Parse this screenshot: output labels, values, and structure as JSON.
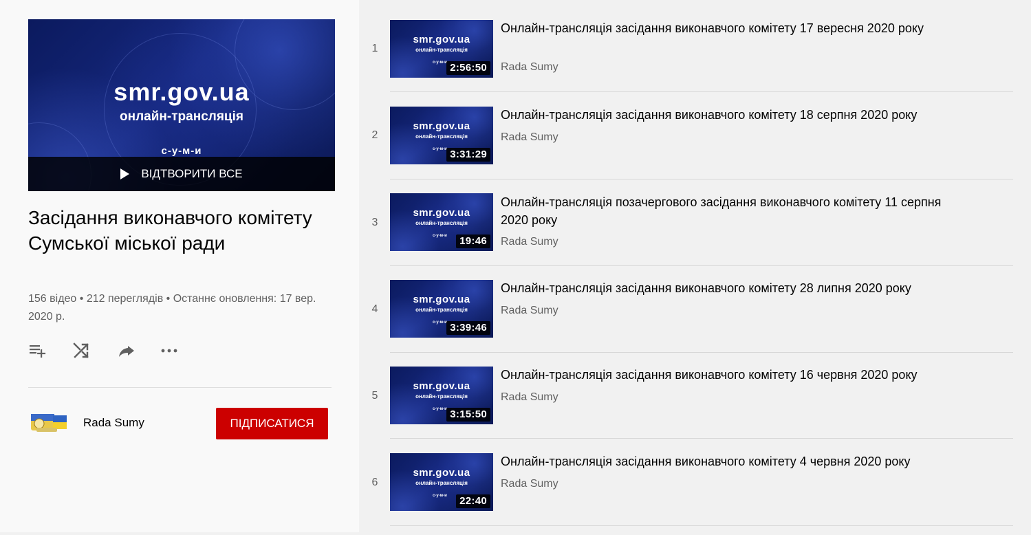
{
  "hero": {
    "logo_text": "smr.gov.ua",
    "subtitle": "онлайн-трансляція",
    "mark": "с-у-м-и",
    "play_all_label": "ВІДТВОРИТИ ВСЕ"
  },
  "playlist": {
    "title": "Засідання виконавчого комітету Сумської міської ради",
    "stats": "156 відео • 212 переглядів • Останнє оновлення: 17 вер. 2020 р."
  },
  "actions": [
    "add-to-queue-icon",
    "shuffle-icon",
    "share-icon",
    "more-icon"
  ],
  "owner": {
    "name": "Rada Sumy",
    "subscribe_label": "ПІДПИСАТИСЯ"
  },
  "colors": {
    "subscribe": "#cc0000",
    "sidebar_bg": "#f9f9f9",
    "list_bg": "#f1f1f1",
    "thumb_bg": "#13237a"
  },
  "videos": [
    {
      "index": "1",
      "title": "Онлайн-трансляція засідання виконавчого комітету 17 вересня 2020 року",
      "channel": "Rada Sumy",
      "duration": "2:56:50"
    },
    {
      "index": "2",
      "title": "Онлайн-трансляція засідання виконавчого комітету 18 серпня 2020 року",
      "channel": "Rada Sumy",
      "duration": "3:31:29"
    },
    {
      "index": "3",
      "title": "Онлайн-трансляція позачергового засідання виконавчого комітету 11 серпня 2020 року",
      "channel": "Rada Sumy",
      "duration": "19:46"
    },
    {
      "index": "4",
      "title": "Онлайн-трансляція засідання виконавчого комітету 28 липня 2020 року",
      "channel": "Rada Sumy",
      "duration": "3:39:46"
    },
    {
      "index": "5",
      "title": "Онлайн-трансляція засідання виконавчого комітету 16 червня 2020 року",
      "channel": "Rada Sumy",
      "duration": "3:15:50"
    },
    {
      "index": "6",
      "title": "Онлайн-трансляція засідання виконавчого комітету 4 червня 2020 року",
      "channel": "Rada Sumy",
      "duration": "22:40"
    }
  ]
}
